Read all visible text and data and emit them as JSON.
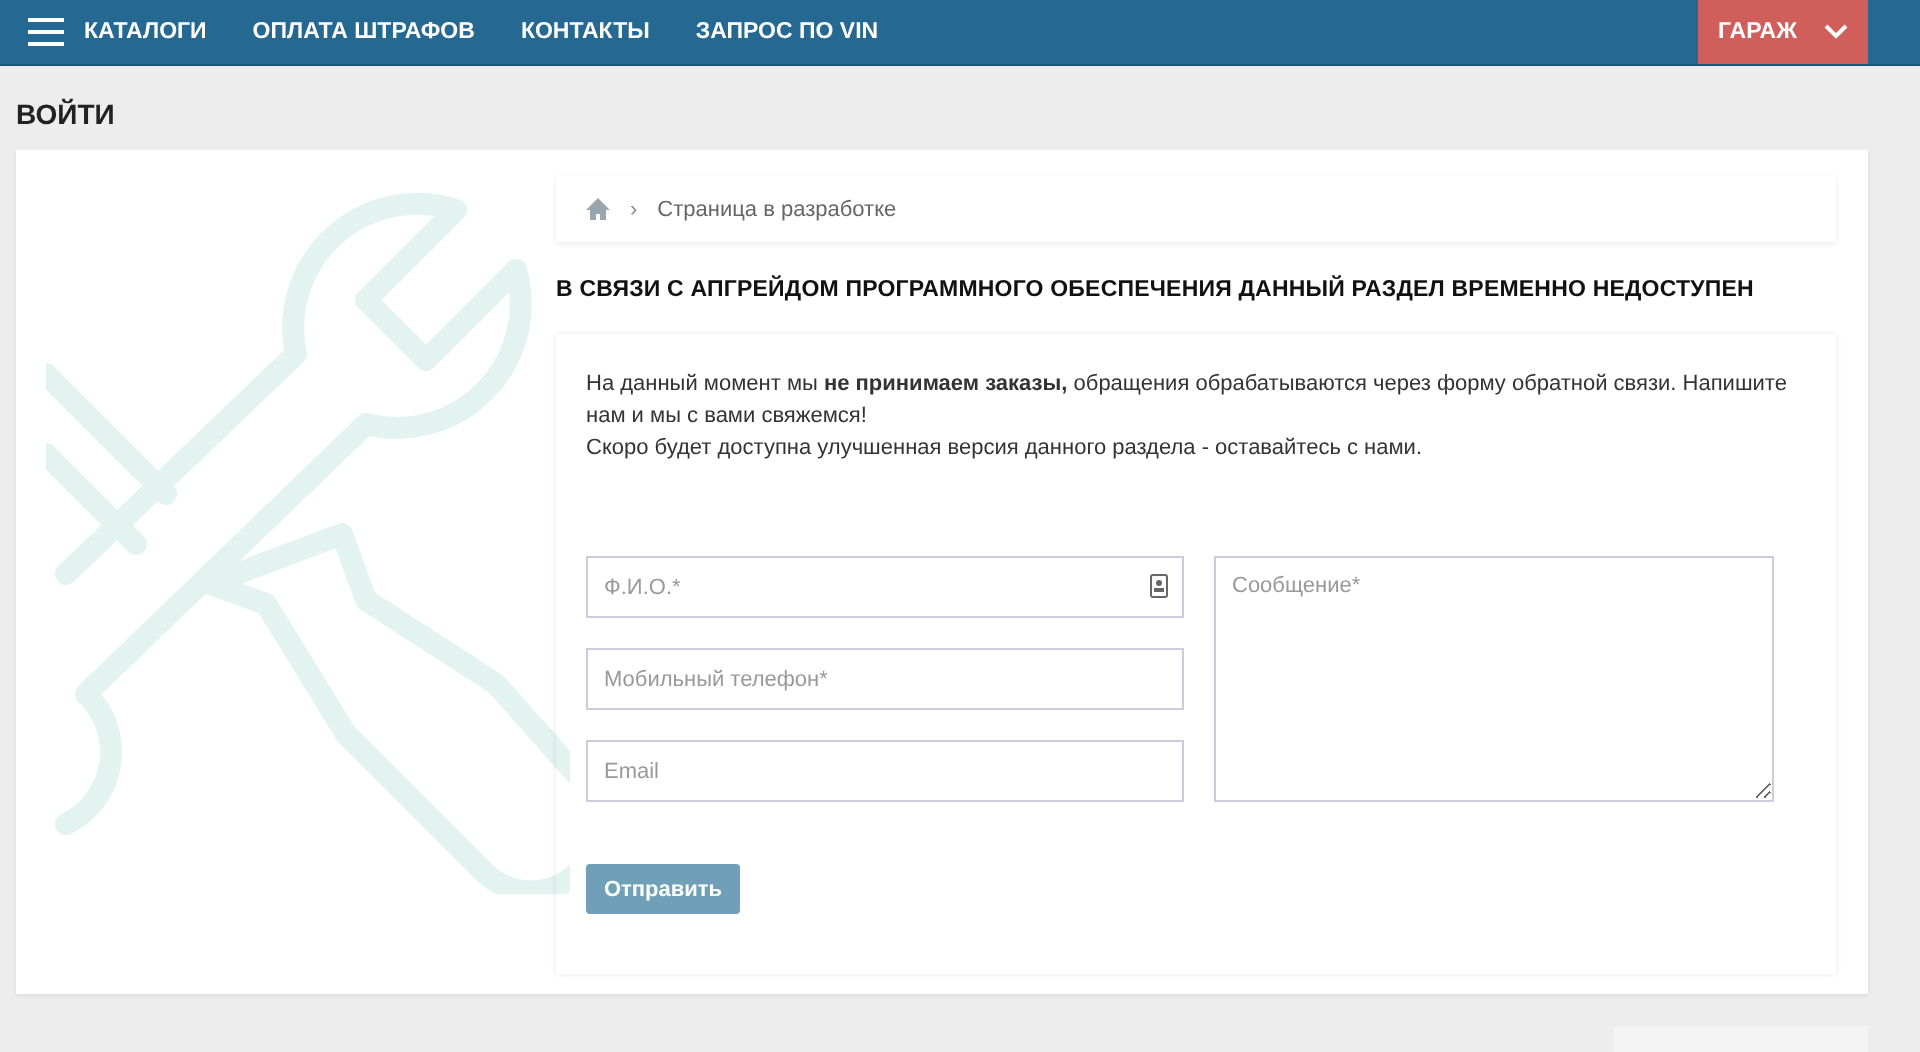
{
  "nav": {
    "items": [
      {
        "label": "КАТАЛОГИ"
      },
      {
        "label": "ОПЛАТА ШТРАФОВ"
      },
      {
        "label": "КОНТАКТЫ"
      },
      {
        "label": "ЗАПРОС ПО VIN"
      }
    ],
    "garage": {
      "label": "ГАРАЖ"
    }
  },
  "page_title": "ВОЙТИ",
  "breadcrumb": {
    "separator": "›",
    "current": "Страница в разработке"
  },
  "heading": "В СВЯЗИ С АПГРЕЙДОМ ПРОГРАММНОГО ОБЕСПЕЧЕНИЯ ДАННЫЙ РАЗДЕЛ ВРЕМЕННО НЕДОСТУПЕН",
  "notice": {
    "paragraphs": [
      "На данный момент мы **не принимаем заказы,** обращения обрабатываются через форму обратной связи. Напишите нам и мы с вами свяжемся!",
      "Скоро будет доступна улучшенная версия данного раздела - оставайтесь с нами."
    ]
  },
  "form": {
    "fields": [
      {
        "placeholder": "Ф.И.О.*",
        "autofill_icon": true
      },
      {
        "placeholder": "Мобильный телефон*",
        "autofill_icon": false
      },
      {
        "placeholder": "Email",
        "autofill_icon": false
      }
    ],
    "message": {
      "placeholder": "Сообщение*"
    },
    "submit": "Отправить"
  }
}
